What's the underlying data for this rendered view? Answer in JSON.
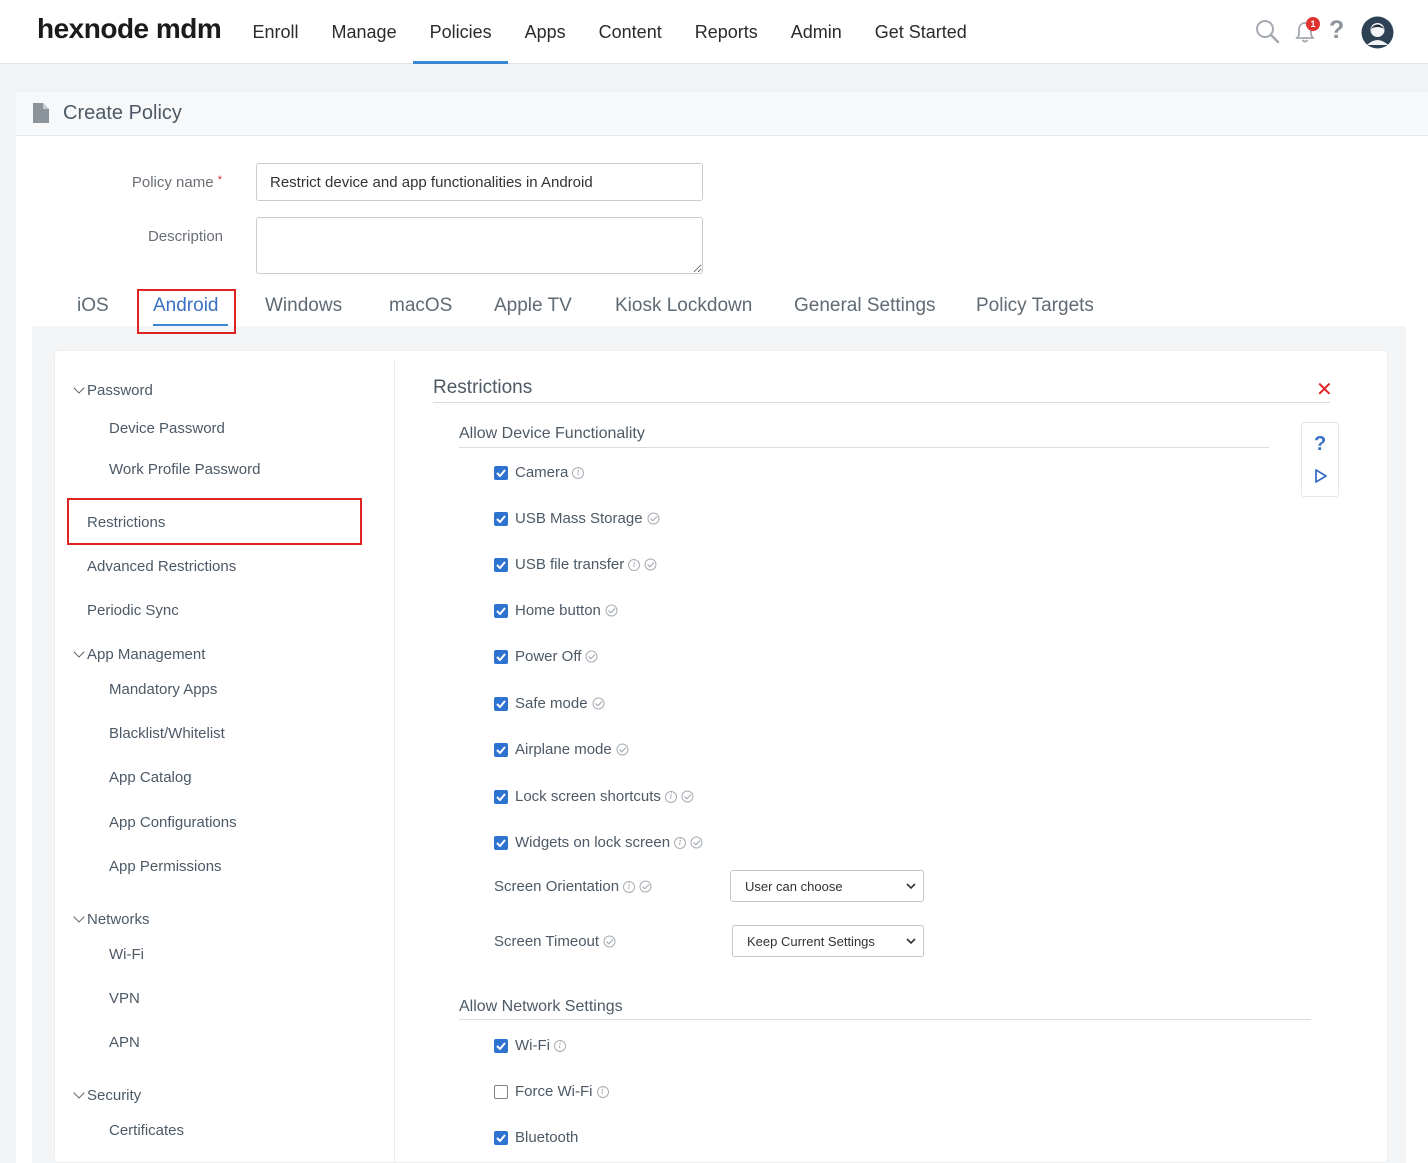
{
  "app": {
    "logo": "hexnode mdm"
  },
  "nav": {
    "items": [
      "Enroll",
      "Manage",
      "Policies",
      "Apps",
      "Content",
      "Reports",
      "Admin",
      "Get Started"
    ],
    "active": "Policies",
    "notification_count": "1"
  },
  "page": {
    "title": "Create Policy",
    "policy_name_label": "Policy name",
    "policy_name_required": "*",
    "policy_name_value": "Restrict device and app functionalities in Android",
    "description_label": "Description",
    "description_value": ""
  },
  "os_tabs": [
    "iOS",
    "Android",
    "Windows",
    "macOS",
    "Apple TV",
    "Kiosk Lockdown",
    "General Settings",
    "Policy Targets"
  ],
  "os_tab_active": "Android",
  "sidebar": {
    "password_group": "Password",
    "device_password": "Device Password",
    "work_profile_password": "Work Profile Password",
    "restrictions": "Restrictions",
    "advanced_restrictions": "Advanced Restrictions",
    "periodic_sync": "Periodic Sync",
    "app_management_group": "App Management",
    "mandatory_apps": "Mandatory Apps",
    "blacklist_whitelist": "Blacklist/Whitelist",
    "app_catalog": "App Catalog",
    "app_configurations": "App Configurations",
    "app_permissions": "App Permissions",
    "networks_group": "Networks",
    "wifi": "Wi-Fi",
    "vpn": "VPN",
    "apn": "APN",
    "security_group": "Security",
    "certificates": "Certificates"
  },
  "restrictions": {
    "title": "Restrictions",
    "device_section": "Allow Device Functionality",
    "options": [
      {
        "label": "Camera",
        "checked": true
      },
      {
        "label": "USB Mass Storage",
        "checked": true
      },
      {
        "label": "USB file transfer",
        "checked": true
      },
      {
        "label": "Home button",
        "checked": true
      },
      {
        "label": "Power Off",
        "checked": true
      },
      {
        "label": "Safe mode",
        "checked": true
      },
      {
        "label": "Airplane mode",
        "checked": true
      },
      {
        "label": "Lock screen shortcuts",
        "checked": true
      },
      {
        "label": "Widgets on lock screen",
        "checked": true
      }
    ],
    "screen_orientation_label": "Screen Orientation",
    "screen_orientation_value": "User can choose",
    "screen_timeout_label": "Screen Timeout",
    "screen_timeout_value": "Keep Current Settings",
    "network_section": "Allow Network Settings",
    "network_options": [
      {
        "label": "Wi-Fi",
        "checked": true
      },
      {
        "label": "Force Wi-Fi",
        "checked": false
      },
      {
        "label": "Bluetooth",
        "checked": true
      }
    ]
  },
  "icons": {
    "search": "search-icon",
    "bell": "bell-icon",
    "help": "help-icon",
    "avatar": "avatar",
    "close": "close-icon",
    "info": "info-icon",
    "supported": "check-circle-icon"
  },
  "colors": {
    "accent": "#3a87d6",
    "checkbox": "#2f73d0",
    "highlight": "#e02424"
  }
}
